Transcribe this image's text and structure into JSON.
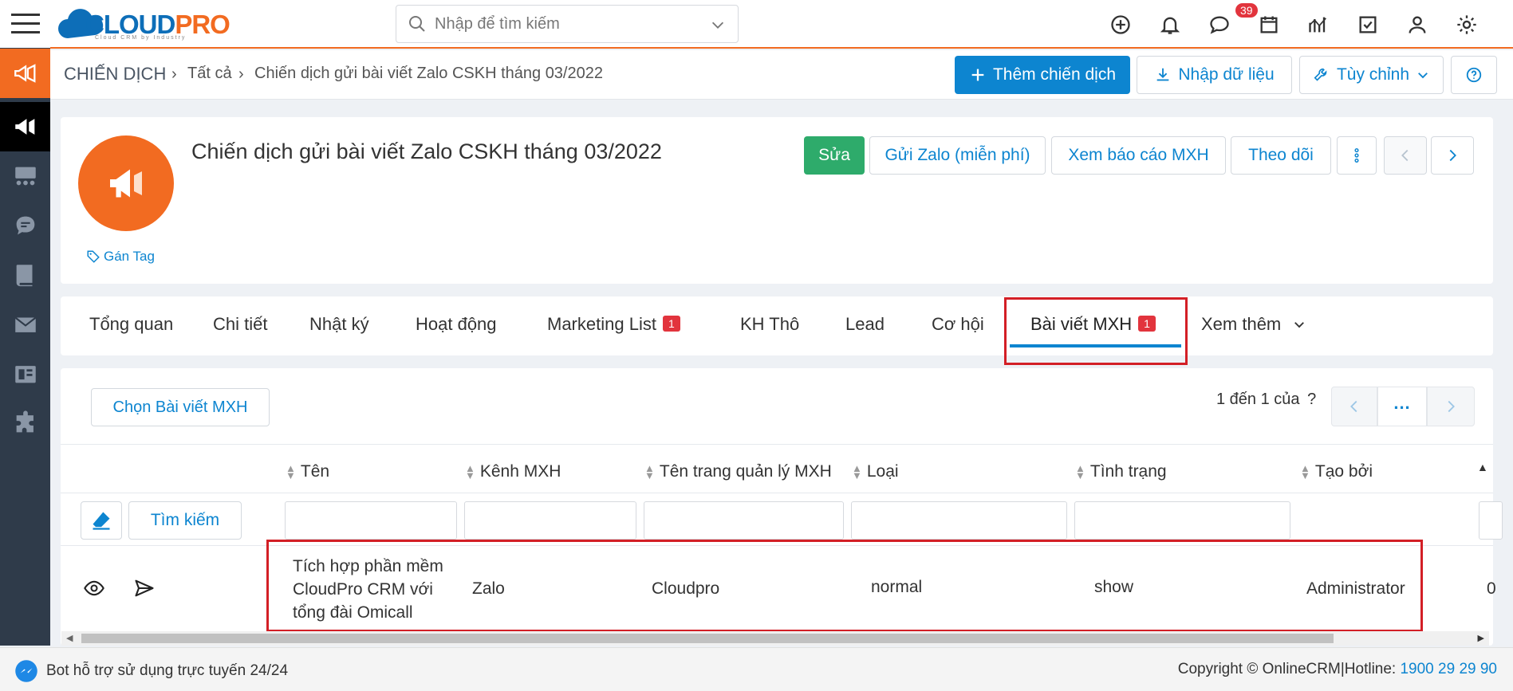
{
  "app": {
    "logo_main": "CLOUD",
    "logo_accent": "PRO",
    "logo_tagline": "Cloud CRM by Industry"
  },
  "search": {
    "placeholder": "Nhập để tìm kiếm"
  },
  "topbar": {
    "notification_count": "39",
    "icons": [
      "add-icon",
      "bell-icon",
      "chat-icon",
      "calendar-icon",
      "chart-icon",
      "task-icon",
      "user-icon",
      "gear-icon"
    ]
  },
  "breadcrumb": {
    "module": "CHIẾN DỊCH",
    "level1": "Tất cả",
    "level2": "Chiến dịch gửi bài viết Zalo CSKH tháng 03/2022"
  },
  "actions": {
    "add_campaign": "Thêm chiến dịch",
    "import_data": "Nhập dữ liệu",
    "customize": "Tùy chỉnh"
  },
  "record": {
    "title": "Chiến dịch gửi bài viết Zalo CSKH tháng 03/2022",
    "tag_label": "Gán Tag",
    "edit": "Sửa",
    "send_zalo": "Gửi Zalo (miễn phí)",
    "view_report": "Xem báo cáo MXH",
    "follow": "Theo dõi"
  },
  "tabs": [
    {
      "label": "Tổng quan"
    },
    {
      "label": "Chi tiết"
    },
    {
      "label": "Nhật ký"
    },
    {
      "label": "Hoạt động"
    },
    {
      "label": "Marketing List",
      "badge": "1"
    },
    {
      "label": "KH Thô"
    },
    {
      "label": "Lead"
    },
    {
      "label": "Cơ hội"
    },
    {
      "label": "Bài viết MXH",
      "badge": "1",
      "active": true
    },
    {
      "label": "Xem thêm"
    }
  ],
  "related": {
    "select_button": "Chọn Bài viết MXH",
    "pager_text": "1 đến 1 của",
    "pager_help": "?",
    "pager_more": "...",
    "search_button": "Tìm kiếm",
    "columns": [
      "Tên",
      "Kênh MXH",
      "Tên trang quản lý MXH",
      "Loại",
      "Tình trạng",
      "Tạo bởi"
    ],
    "rows": [
      {
        "name_line1": "Tích hợp phần mềm",
        "name_line2": "CloudPro CRM với",
        "name_line3": "tổng đài Omicall",
        "channel": "Zalo",
        "page": "Cloudpro",
        "type": "normal",
        "status": "show",
        "created_by": "Administrator",
        "overflow": "0"
      }
    ]
  },
  "footer": {
    "bot_text": "Bot hỗ trợ sử dụng trực tuyến 24/24",
    "copyright": "Copyright © OnlineCRM",
    "hotline_label": "|Hotline: ",
    "hotline": "1900 29 29 90"
  },
  "colors": {
    "brand_blue": "#0d85d0",
    "brand_orange": "#f26b21",
    "sidebar_bg": "#2f3b4a",
    "success_green": "#2eab6b",
    "badge_red": "#e2343d"
  }
}
